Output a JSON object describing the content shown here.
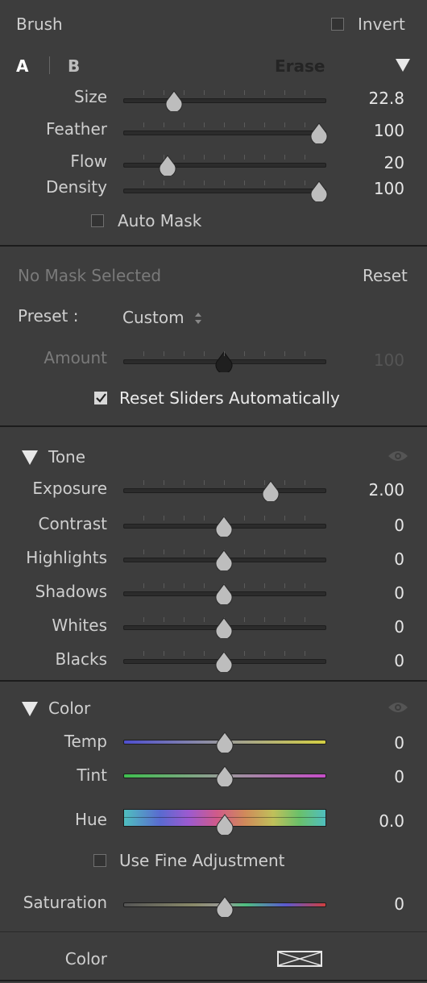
{
  "brush": {
    "title": "Brush",
    "invert_label": "Invert",
    "tab_a": "A",
    "tab_b": "B",
    "erase": "Erase",
    "auto_mask": "Auto Mask",
    "sliders": [
      {
        "label": "Size",
        "value": "22.8",
        "fraction": 0.25
      },
      {
        "label": "Feather",
        "value": "100",
        "fraction": 0.97
      },
      {
        "label": "Flow",
        "value": "20",
        "fraction": 0.22
      },
      {
        "label": "Density",
        "value": "100",
        "fraction": 0.97
      }
    ]
  },
  "mask": {
    "status": "No Mask Selected",
    "reset": "Reset",
    "preset_label": "Preset :",
    "preset_value": "Custom",
    "amount_label": "Amount",
    "amount_value": "100",
    "amount_fraction": 0.5,
    "reset_sliders": "Reset Sliders Automatically"
  },
  "tone": {
    "title": "Tone",
    "sliders": [
      {
        "label": "Exposure",
        "value": "2.00",
        "fraction": 0.73
      },
      {
        "label": "Contrast",
        "value": "0",
        "fraction": 0.5
      },
      {
        "label": "Highlights",
        "value": "0",
        "fraction": 0.5
      },
      {
        "label": "Shadows",
        "value": "0",
        "fraction": 0.5
      },
      {
        "label": "Whites",
        "value": "0",
        "fraction": 0.5
      },
      {
        "label": "Blacks",
        "value": "0",
        "fraction": 0.5
      }
    ]
  },
  "color": {
    "title": "Color",
    "temp_label": "Temp",
    "temp_value": "0",
    "tint_label": "Tint",
    "tint_value": "0",
    "hue_label": "Hue",
    "hue_value": "0.0",
    "fine_adjust": "Use Fine Adjustment",
    "saturation_label": "Saturation",
    "saturation_value": "0",
    "swatch_label": "Color"
  }
}
